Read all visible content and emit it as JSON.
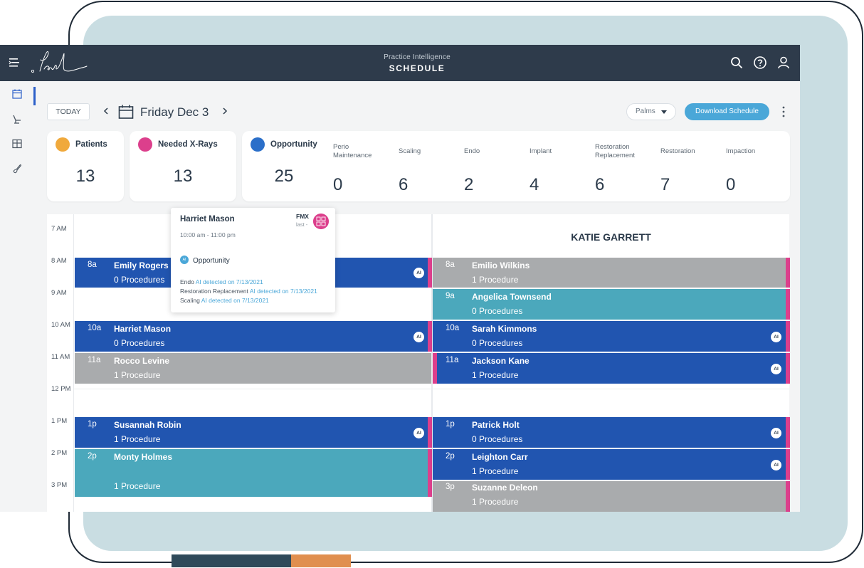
{
  "header": {
    "subtitle": "Practice Intelligence",
    "title": "SCHEDULE"
  },
  "toolbar": {
    "today_label": "TODAY",
    "date_label": "Friday Dec 3",
    "location_dropdown": "Palms",
    "download_label": "Download Schedule"
  },
  "stats": {
    "patients": {
      "label": "Patients",
      "value": "13"
    },
    "xrays": {
      "label": "Needed X-Rays",
      "value": "13"
    },
    "opportunity": {
      "label": "Opportunity",
      "value": "25"
    },
    "breakdown": [
      {
        "label": "Perio\nMaintenance",
        "value": "0"
      },
      {
        "label": "Scaling",
        "value": "6"
      },
      {
        "label": "Endo",
        "value": "2"
      },
      {
        "label": "Implant",
        "value": "4"
      },
      {
        "label": "Restoration\nReplacement",
        "value": "6"
      },
      {
        "label": "Restoration",
        "value": "7"
      },
      {
        "label": "Impaction",
        "value": "0"
      }
    ]
  },
  "schedule": {
    "times": [
      "7 AM",
      "8 AM",
      "9 AM",
      "10 AM",
      "11 AM",
      "12 PM",
      "1 PM",
      "2 PM",
      "3 PM"
    ],
    "provider_right": "KATIE GARRETT",
    "left": [
      {
        "time": "8a",
        "name": "Emily Rogers",
        "procedures": "0 Procedures",
        "ai": "AI"
      },
      {
        "time": "10a",
        "name": "Harriet Mason",
        "procedures": "0 Procedures",
        "ai": "AI"
      },
      {
        "time": "11a",
        "name": "Rocco Levine",
        "procedures": "1 Procedure"
      },
      {
        "time": "1p",
        "name": "Susannah Robin",
        "procedures": "1 Procedure",
        "ai": "AI"
      },
      {
        "time": "2p",
        "name": "Monty Holmes",
        "procedures": "1 Procedure"
      }
    ],
    "right": [
      {
        "time": "8a",
        "name": "Emilio Wilkins",
        "procedures": "1 Procedure"
      },
      {
        "time": "9a",
        "name": "Angelica Townsend",
        "procedures": "0 Procedures"
      },
      {
        "time": "10a",
        "name": "Sarah Kimmons",
        "procedures": "0 Procedures",
        "ai": "AI"
      },
      {
        "time": "11a",
        "name": "Jackson Kane",
        "procedures": "1 Procedure",
        "ai": "AI"
      },
      {
        "time": "1p",
        "name": "Patrick Holt",
        "procedures": "0 Procedures",
        "ai": "AI"
      },
      {
        "time": "2p",
        "name": "Leighton Carr",
        "procedures": "1 Procedure",
        "ai": "AI"
      },
      {
        "time": "3p",
        "name": "Suzanne Deleon",
        "procedures": "1 Procedure"
      }
    ]
  },
  "popover": {
    "name": "Harriet Mason",
    "time": "10:00 am - 11:00 pm",
    "fmx": "FMX",
    "last": "last -",
    "opportunity_icon": "AI",
    "opportunity_label": "Opportunity",
    "items": [
      {
        "label": "Endo ",
        "link": "AI detected on 7/13/2021"
      },
      {
        "label": "Restoration Replacement ",
        "link": "AI detected on 7/13/2021"
      },
      {
        "label": "Scaling ",
        "link": "AI detected on 7/13/2021"
      }
    ]
  },
  "colors": {
    "topbar": "#2e3b4b",
    "blue_appt": "#2155b0",
    "gray_appt": "#a9abad",
    "teal_appt": "#4ba8bc",
    "pink_flag": "#dc3f8c",
    "accent_button": "#4aa7d8"
  }
}
